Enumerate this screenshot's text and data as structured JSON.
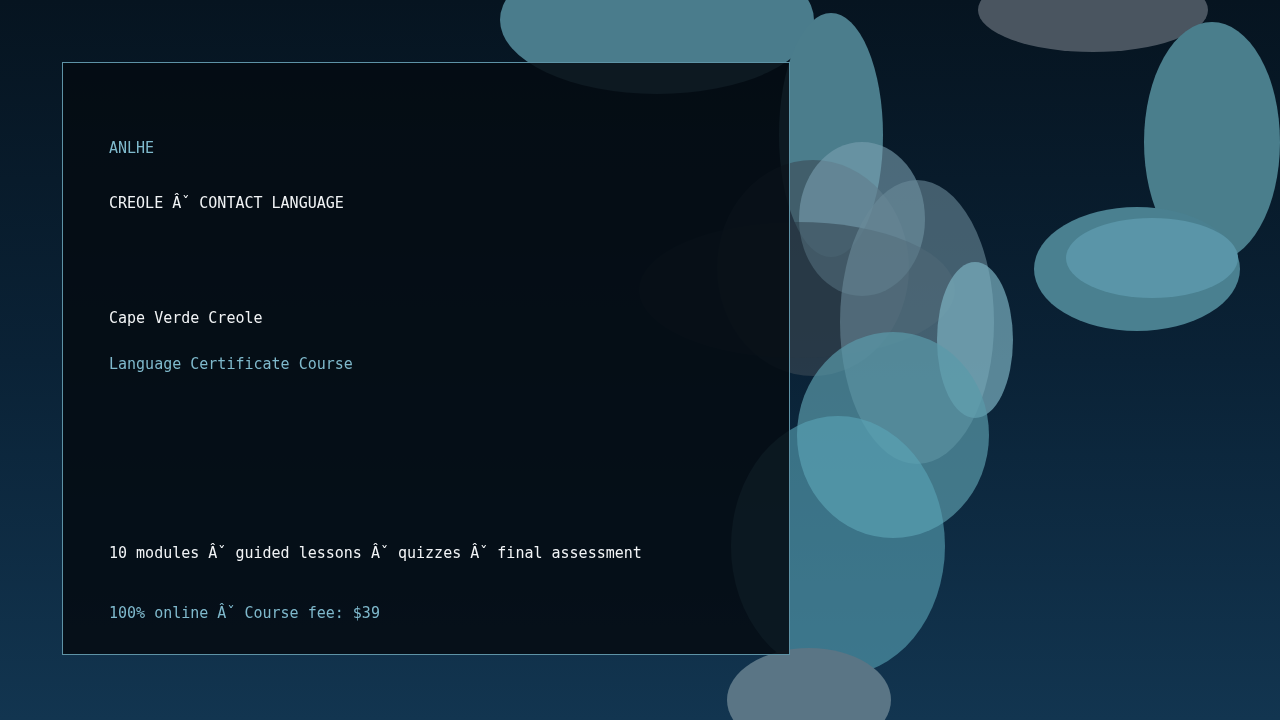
{
  "brand": "ANLHE",
  "category": "CREOLE Âˇ CONTACT LANGUAGE",
  "title": "Cape Verde Creole",
  "subtitle": "Language Certificate Course",
  "features": "10 modules Âˇ guided lessons Âˇ quizzes Âˇ final assessment",
  "price_line": "100% online Âˇ Course fee: $39"
}
